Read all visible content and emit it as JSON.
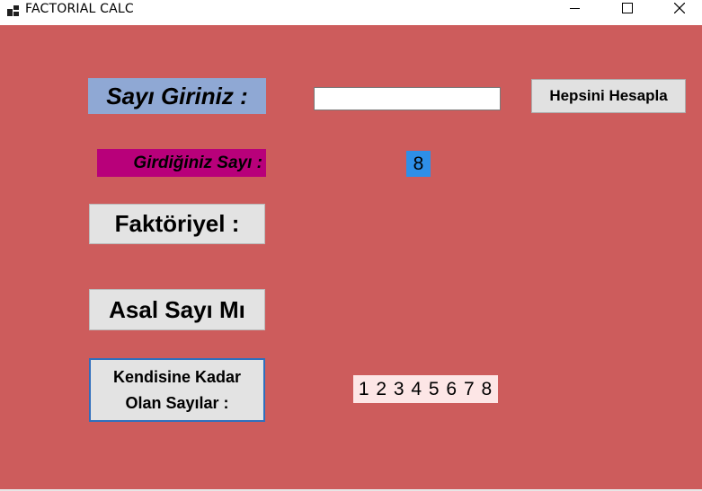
{
  "window": {
    "title": "FACTORIAL CALC",
    "icon": "app-window-icon",
    "controls": {
      "minimize": "minimize-icon",
      "maximize": "maximize-icon",
      "close": "close-icon"
    }
  },
  "colors": {
    "form_background": "#cd5c5c",
    "enter_label_bg": "#8fa8d4",
    "entered_label_bg": "#b8007a",
    "number_value_bg": "#2e8fe8",
    "sequence_value_bg": "#fde6e6",
    "button_bg": "#e1e1e1"
  },
  "form": {
    "enter_label": "Sayı Giriniz :",
    "number_input": {
      "value": "",
      "placeholder": ""
    },
    "calculate_button": "Hepsini Hesapla",
    "entered_label": "Girdiğiniz Sayı :",
    "entered_value": "8",
    "factorial_label": "Faktöriyel :",
    "prime_label": "Asal Sayı Mı",
    "numbers_up_to_label": "Kendisine Kadar\nOlan Sayılar :",
    "numbers_up_to_value": "1 2 3 4 5 6 7 8"
  }
}
